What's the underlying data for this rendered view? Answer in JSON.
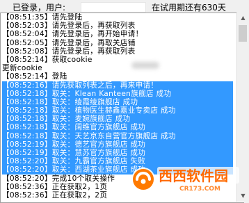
{
  "status": {
    "logged_label": "已登录，",
    "user_label": "用户:",
    "trial_label": "在试用期还有630天"
  },
  "log": [
    {
      "text": "【08:51:35】请先登陆",
      "highlight": false
    },
    {
      "text": "【08:52:03】请先登录后，再获取列表",
      "highlight": false
    },
    {
      "text": "【08:52:04】请先登录后，再开始申请！",
      "highlight": false
    },
    {
      "text": "【08:52:05】请先登录后，再取关店铺",
      "highlight": false
    },
    {
      "text": "【08:52:08】请先登录后，再获取列表",
      "highlight": false
    },
    {
      "text": "【08:52:14】获取cookie",
      "highlight": false
    },
    {
      "text": "更新cookie",
      "highlight": false
    },
    {
      "text": "【08:52:14】登陆",
      "highlight": false
    },
    {
      "text": "【08:52:16】请先获取列表之后，再来申请！",
      "highlight": true
    },
    {
      "text": "【08:52:18】取关：Klean Kanteen旗舰店 成功",
      "highlight": true
    },
    {
      "text": "【08:52:18】取关：绫霞绫旗舰店 成功",
      "highlight": true
    },
    {
      "text": "【08:52:18】取关：植物医生赫鑫嘉业专卖店 成功",
      "highlight": true
    },
    {
      "text": "【08:52:18】取关：麦婉旗舰店 成功",
      "highlight": true
    },
    {
      "text": "【08:52:18】取关：阔维官方旗舰店 成功",
      "highlight": true
    },
    {
      "text": "【08:52:18】取关：天艺京东自营官方旗舰店 成功",
      "highlight": true
    },
    {
      "text": "【08:52:19】取关：德艺官方旗舰店 成功",
      "highlight": true
    },
    {
      "text": "【08:52:19】取关：慧苏官方旗舰店 成功",
      "highlight": true
    },
    {
      "text": "【08:52:20】取关：九霸官方旗舰店 失败",
      "highlight": true
    },
    {
      "text": "【08:52:20】取关：西湖茶业旗舰店 成功",
      "highlight": true
    },
    {
      "text": "【08:52:20】完成10个取关操作",
      "highlight": false
    },
    {
      "text": "【08:52:36】正在获取2，1页",
      "highlight": false
    },
    {
      "text": "【08:52:36】正在获取2，2页",
      "highlight": false
    }
  ],
  "watermark": {
    "brand": "西西软件园",
    "url": "CR173.COM"
  },
  "icons": {
    "scroll_up": "scroll-up-arrow-icon",
    "scroll_down": "scroll-down-arrow-icon",
    "logo": "cr173-logo-icon"
  },
  "colors": {
    "highlight": "#3399ff",
    "brand": "#ff6a00"
  }
}
